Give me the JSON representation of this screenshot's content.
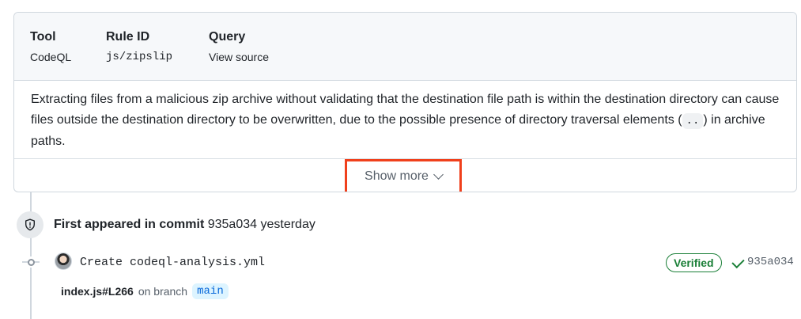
{
  "card": {
    "meta": [
      {
        "title": "Tool",
        "value": "CodeQL"
      },
      {
        "title": "Rule ID",
        "value": "js/zipslip"
      },
      {
        "title": "Query",
        "value": "View source"
      }
    ],
    "description_before": "Extracting files from a malicious zip archive without validating that the destination file path is within the destination directory can cause files outside the destination directory to be overwritten, due to the possible presence of directory traversal elements (",
    "description_code": "..",
    "description_after": ") in archive paths.",
    "show_more_label": "Show more"
  },
  "timeline": {
    "event_label": "First appeared in commit",
    "event_sha": "935a034",
    "event_time": "yesterday",
    "commit_message": "Create codeql-analysis.yml",
    "verified_label": "Verified",
    "commit_sha": "935a034",
    "file_ref": "index.js#L266",
    "on_branch_text": "on branch",
    "branch": "main"
  },
  "icons": {
    "shield": "shield-alert-icon",
    "chevron": "chevron-down-icon",
    "check": "check-icon",
    "commit": "git-commit-icon"
  },
  "colors": {
    "highlight_border": "#f0401c",
    "verified": "#1a7f37",
    "link": "#0969da"
  }
}
